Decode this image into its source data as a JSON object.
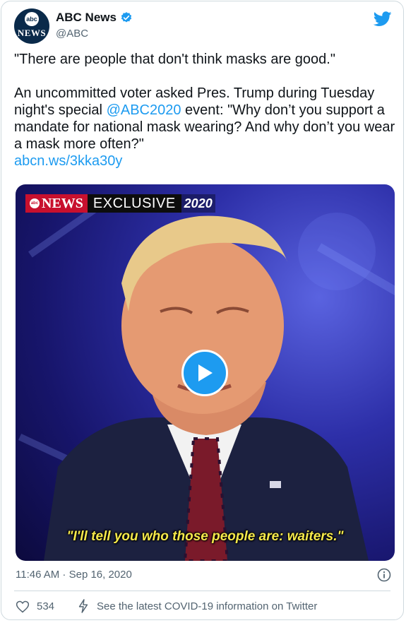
{
  "header": {
    "avatar": {
      "circle_text": "abc",
      "news_text": "NEWS"
    },
    "display_name": "ABC News",
    "handle": "@ABC",
    "verified_icon": "verified-badge-icon",
    "brand_icon": "twitter-bird-icon"
  },
  "tweet": {
    "line1": "\"There are people that don't think masks are good.\"",
    "line2_prefix": "An uncommitted voter asked Pres. Trump during Tuesday night's special ",
    "mention": "@ABC2020",
    "line2_suffix": " event: \"Why don’t you support a mandate for national mask wearing? And why don’t you wear a mask more often?\"",
    "link": "abcn.ws/3kka30y"
  },
  "media": {
    "banner_news": "NEWS",
    "banner_abc": "abc",
    "banner_exclusive": "EXCLUSIVE",
    "banner_2020": "2020",
    "caption": "\"I'll tell you who those people are: waiters.\"",
    "play_icon": "play-icon"
  },
  "footer": {
    "timestamp": "11:46 AM · Sep 16, 2020",
    "info_icon": "info-icon",
    "like_count": "534",
    "covid_text": "See the latest COVID-19 information on Twitter"
  },
  "colors": {
    "accent": "#1d9bf0",
    "text": "#0f1419",
    "muted": "#536471",
    "banner_red": "#c8102e",
    "caption_yellow": "#f5e94b"
  }
}
